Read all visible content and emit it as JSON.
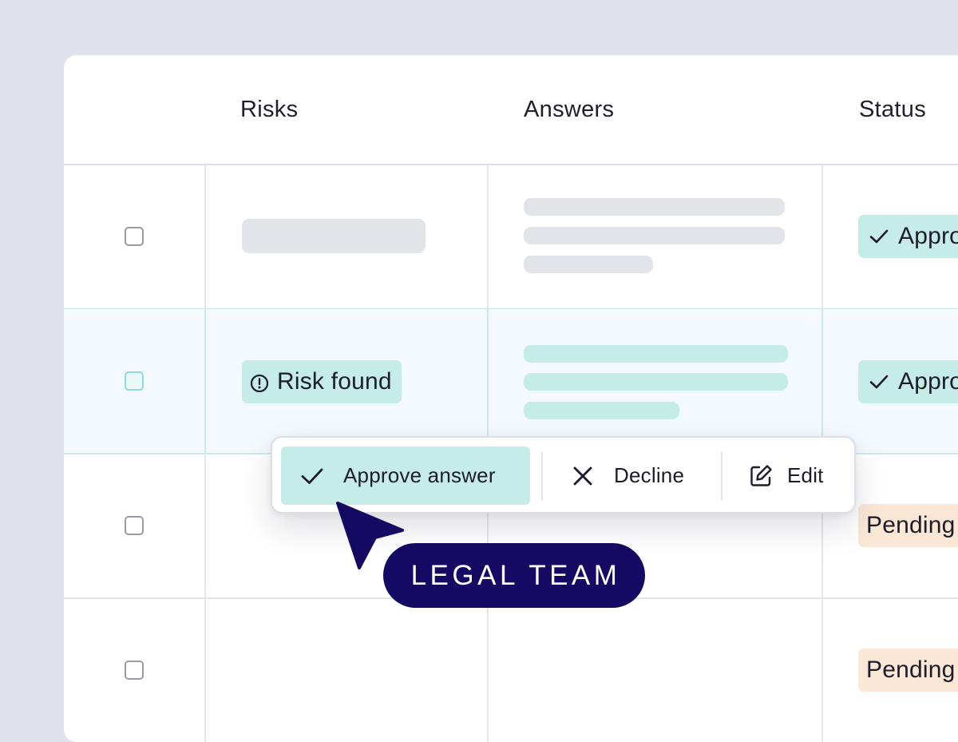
{
  "table": {
    "columns": {
      "risks": "Risks",
      "answers": "Answers",
      "status": "Status"
    },
    "rows": [
      {
        "risk_label": "",
        "status_label": "Approved",
        "status_type": "approved"
      },
      {
        "risk_label": "Risk found",
        "status_label": "Approved",
        "status_type": "approved"
      },
      {
        "risk_label": "",
        "status_label": "Pending",
        "status_type": "pending"
      },
      {
        "risk_label": "",
        "status_label": "Pending",
        "status_type": "pending"
      }
    ]
  },
  "popover": {
    "approve_label": "Approve answer",
    "decline_label": "Decline",
    "edit_label": "Edit"
  },
  "cursor_tag": {
    "label": "LEGAL TEAM"
  },
  "icons": {
    "check": "check-icon",
    "close": "close-icon",
    "edit": "edit-icon",
    "alert": "alert-circle-icon",
    "cursor": "cursor-pointer-icon"
  },
  "colors": {
    "background": "#dfe2eb",
    "teal_badge": "#c6ece8",
    "pending_badge": "#fbe7d5",
    "cursor_navy": "#150a63"
  }
}
